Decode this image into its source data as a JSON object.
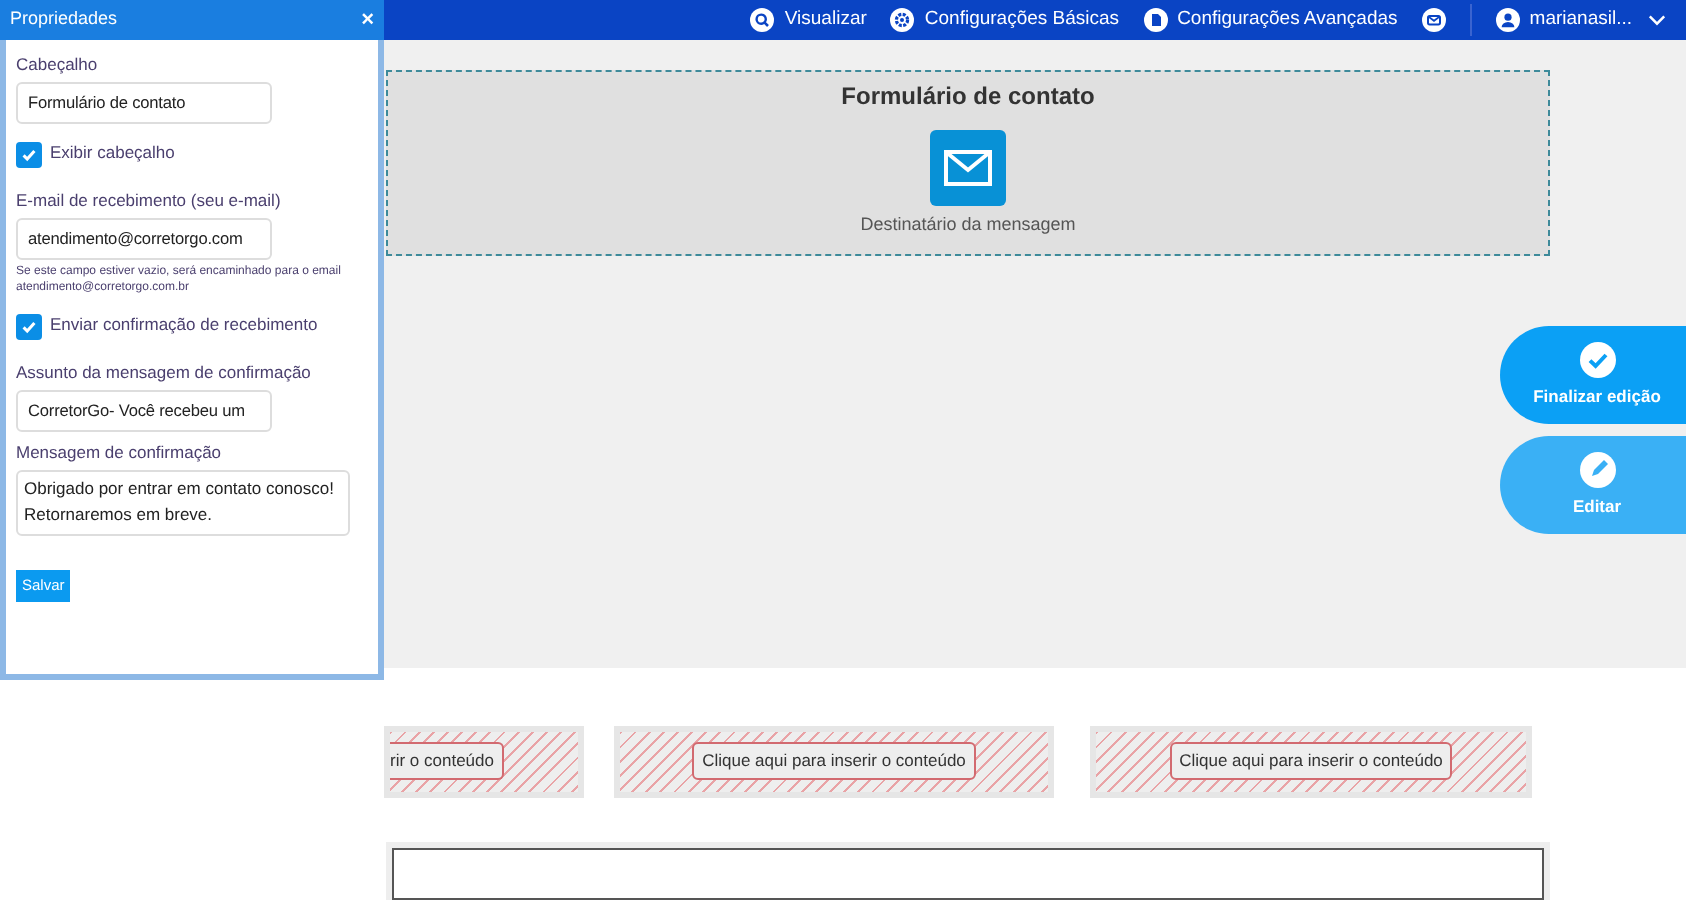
{
  "nav": {
    "items": [
      {
        "kind": "preview",
        "label": "Visualizar"
      },
      {
        "kind": "gear",
        "label": "Configurações Básicas"
      },
      {
        "kind": "file",
        "label": "Configurações Avançadas"
      },
      {
        "kind": "mail"
      }
    ],
    "user": "marianasil..."
  },
  "panel": {
    "title": "Propriedades",
    "close": "×",
    "fields": [
      {
        "kind": "input",
        "label": "Cabeçalho",
        "value": "Formulário de contato"
      },
      {
        "kind": "checkbox",
        "label": "Exibir cabeçalho",
        "checked": true
      },
      {
        "kind": "input",
        "label": "E-mail de recebimento (seu e-mail)",
        "value": "atendimento@corretorgo.com",
        "hint": "Se este campo estiver vazio, será encaminhado para o email atendimento@corretorgo.com.br"
      },
      {
        "kind": "checkbox",
        "label": "Enviar confirmação de recebimento",
        "checked": true
      },
      {
        "kind": "input",
        "label": "Assunto da mensagem de confirmação",
        "value": "CorretorGo- Você recebeu um"
      },
      {
        "kind": "textarea",
        "label": "Mensagem de confirmação",
        "value": "Obrigado por entrar em contato conosco!\nRetornaremos em breve."
      }
    ],
    "save": "Salvar"
  },
  "form_block": {
    "title": "Formulário de contato",
    "caption": "Destinatário da mensagem"
  },
  "actions": [
    {
      "kind": "check",
      "label": "Finalizar edição"
    },
    {
      "kind": "edit",
      "label": "Editar"
    }
  ],
  "slots": [
    "rir o conteúdo",
    "Clique aqui para inserir o conteúdo",
    "Clique aqui para inserir o conteúdo"
  ]
}
